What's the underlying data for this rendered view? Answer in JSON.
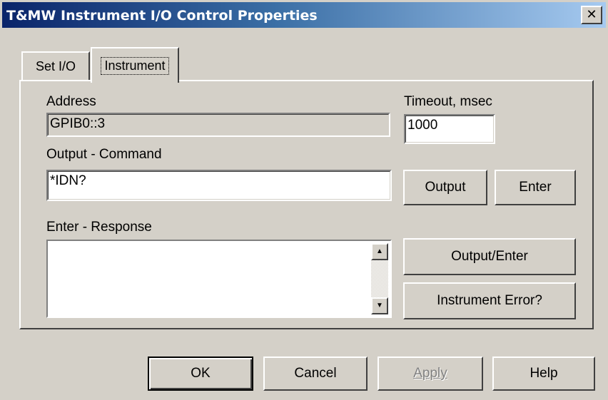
{
  "window": {
    "title": "T&MW Instrument I/O Control Properties",
    "close_glyph": "✕"
  },
  "tabs": [
    {
      "label": "Set I/O"
    },
    {
      "label": "Instrument"
    }
  ],
  "address": {
    "label": "Address",
    "value": "GPIB0::3"
  },
  "timeout": {
    "label": "Timeout, msec",
    "value": "1000"
  },
  "output_command": {
    "label": "Output - Command",
    "value": "*IDN?"
  },
  "enter_response": {
    "label": "Enter - Response",
    "value": ""
  },
  "buttons": {
    "output": "Output",
    "enter": "Enter",
    "output_enter": "Output/Enter",
    "instrument_error": "Instrument Error?"
  },
  "footer": {
    "ok": "OK",
    "cancel": "Cancel",
    "apply": "Apply",
    "help": "Help"
  },
  "icons": {
    "scroll_up": "▲",
    "scroll_down": "▼"
  }
}
